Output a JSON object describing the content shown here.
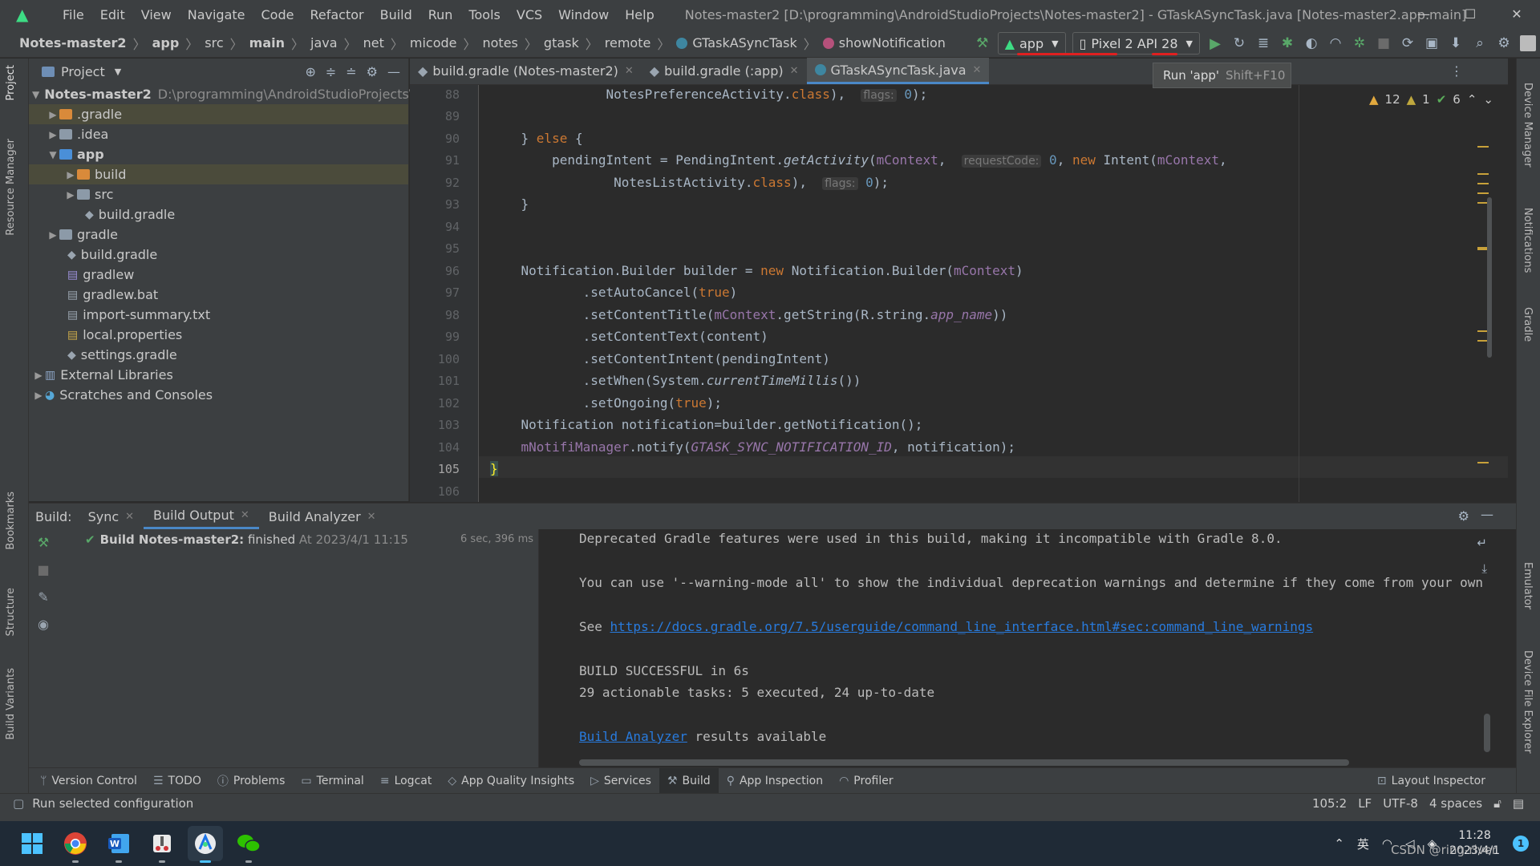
{
  "menu": {
    "items": [
      "File",
      "Edit",
      "View",
      "Navigate",
      "Code",
      "Refactor",
      "Build",
      "Run",
      "Tools",
      "VCS",
      "Window",
      "Help"
    ]
  },
  "window": {
    "title": "Notes-master2 [D:\\programming\\AndroidStudioProjects\\Notes-master2] - GTaskASyncTask.java [Notes-master2.app.main]",
    "minimize": "—",
    "maximize": "☐",
    "close": "✕"
  },
  "breadcrumbs": [
    "Notes-master2",
    "app",
    "src",
    "main",
    "java",
    "net",
    "micode",
    "notes",
    "gtask",
    "remote",
    "GTaskASyncTask",
    "showNotification"
  ],
  "toolbar": {
    "run_config": "app",
    "device": "Pixel 2 API 28"
  },
  "tooltip": {
    "text": "Run 'app'",
    "shortcut": "Shift+F10"
  },
  "left_strip": {
    "project": "Project",
    "resource_manager": "Resource Manager",
    "bookmarks": "Bookmarks",
    "structure": "Structure",
    "build_variants": "Build Variants"
  },
  "right_strip": {
    "device_manager": "Device Manager",
    "notifications": "Notifications",
    "gradle": "Gradle",
    "emulator": "Emulator",
    "device_file_explorer": "Device File Explorer"
  },
  "project": {
    "title": "Project",
    "root": {
      "name": "Notes-master2",
      "path": "D:\\programming\\AndroidStudioProjects\\"
    },
    "items": [
      ".gradle",
      ".idea",
      "app",
      "build",
      "src",
      "build.gradle",
      "gradle",
      "build.gradle",
      "gradlew",
      "gradlew.bat",
      "import-summary.txt",
      "local.properties",
      "settings.gradle",
      "External Libraries",
      "Scratches and Consoles"
    ]
  },
  "tabs": [
    {
      "label": "build.gradle (Notes-master2)"
    },
    {
      "label": "build.gradle (:app)"
    },
    {
      "label": "GTaskASyncTask.java"
    }
  ],
  "editor": {
    "line_numbers": [
      "88",
      "89",
      "90",
      "91",
      "92",
      "93",
      "94",
      "95",
      "96",
      "97",
      "98",
      "99",
      "100",
      "101",
      "102",
      "103",
      "104",
      "105",
      "106"
    ],
    "hints": {
      "flags": "flags:",
      "request_code": "requestCode:"
    },
    "inspections": {
      "warnings": "12",
      "weak_warnings": "1",
      "ok": "6"
    }
  },
  "build": {
    "label": "Build:",
    "tabs": [
      "Sync",
      "Build Output",
      "Build Analyzer"
    ],
    "tree_item": "Build Notes-master2:",
    "tree_status": "finished",
    "tree_time": "At 2023/4/1 11:15",
    "tree_duration": "6 sec, 396 ms",
    "output": {
      "line1": "Deprecated Gradle features were used in this build, making it incompatible with Gradle 8.0.",
      "line2": "You can use '--warning-mode all' to show the individual deprecation warnings and determine if they come from your own",
      "see": "See ",
      "link": "https://docs.gradle.org/7.5/userguide/command_line_interface.html#sec:command_line_warnings",
      "success": "BUILD SUCCESSFUL in 6s",
      "tasks": "29 actionable tasks: 5 executed, 24 up-to-date",
      "analyzer_link": "Build Analyzer",
      "analyzer_rest": " results available"
    }
  },
  "bottom_tabs": [
    "Version Control",
    "TODO",
    "Problems",
    "Terminal",
    "Logcat",
    "App Quality Insights",
    "Services",
    "Build",
    "App Inspection",
    "Profiler",
    "Layout Inspector"
  ],
  "status": {
    "message": "Run selected configuration",
    "position": "105:2",
    "line_sep": "LF",
    "encoding": "UTF-8",
    "indent": "4 spaces"
  },
  "taskbar": {
    "ime": "英",
    "time": "11:28",
    "date": "2023/4/1",
    "notification_count": "1",
    "watermark": "CSDN @ring-river"
  },
  "colors": {
    "accent": "#4a88c7",
    "run_green": "#59a869",
    "annotation_red": "#e02020"
  }
}
